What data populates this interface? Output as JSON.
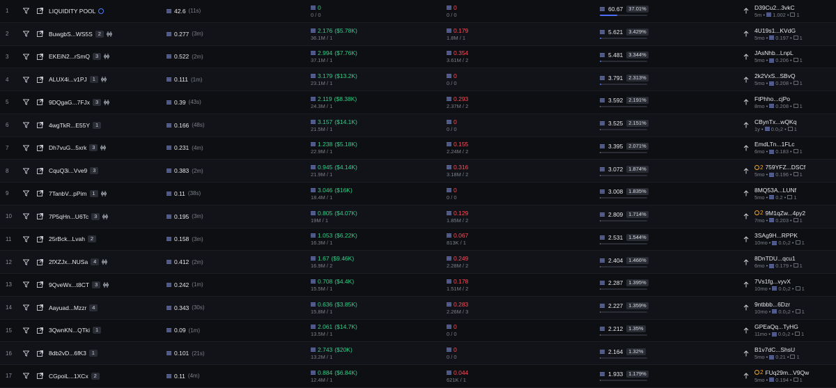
{
  "rows": [
    {
      "idx": "1",
      "name": "LIQUIDITY POOL",
      "count": "",
      "pair": false,
      "info": true,
      "liq": "42.6",
      "age": "(11s)",
      "buy": "0",
      "buy_usd": "",
      "buy_sub": "0 / 0",
      "sell": "0",
      "sell_sub": "0 / 0",
      "vol": "60.67",
      "pct": "37.01%",
      "share": 0.3701,
      "warn": "",
      "addr": "D39Cu2...3vkC",
      "ago": "5m",
      "bal": "1.002",
      "holders": "1"
    },
    {
      "idx": "2",
      "name": "BuwgbS...WS5S",
      "count": "2",
      "pair": true,
      "info": false,
      "liq": "0.277",
      "age": "(3m)",
      "buy": "2.176",
      "buy_usd": "($5.78K)",
      "buy_sub": "36.1M / 1",
      "sell": "0.179",
      "sell_sub": "1.8M / 1",
      "vol": "5.621",
      "pct": "3.429%",
      "share": 0.03429,
      "warn": "",
      "addr": "4U19s1...KVdG",
      "ago": "5mo",
      "bal": "0.197",
      "holders": "1"
    },
    {
      "idx": "3",
      "name": "EKEiN2...rSmQ",
      "count": "3",
      "pair": true,
      "info": false,
      "liq": "0.522",
      "age": "(2m)",
      "buy": "2.994",
      "buy_usd": "($7.76K)",
      "buy_sub": "37.1M / 1",
      "sell": "0.354",
      "sell_sub": "3.61M / 2",
      "vol": "5.481",
      "pct": "3.344%",
      "share": 0.03344,
      "warn": "",
      "addr": "JAsNhb...LnpL",
      "ago": "5mo",
      "bal": "0.206",
      "holders": "1"
    },
    {
      "idx": "4",
      "name": "ALUX4i...v1PJ",
      "count": "1",
      "pair": true,
      "info": false,
      "liq": "0.111",
      "age": "(1m)",
      "buy": "3.179",
      "buy_usd": "($13.2K)",
      "buy_sub": "23.1M / 1",
      "sell": "0",
      "sell_sub": "0 / 0",
      "vol": "3.791",
      "pct": "2.313%",
      "share": 0.02313,
      "warn": "",
      "addr": "2k2VxS...SBvQ",
      "ago": "5mo",
      "bal": "0.208",
      "holders": "1"
    },
    {
      "idx": "5",
      "name": "9DQgaG...7FJx",
      "count": "3",
      "pair": true,
      "info": false,
      "liq": "0.39",
      "age": "(43s)",
      "buy": "2.119",
      "buy_usd": "($8.38K)",
      "buy_sub": "24.3M / 1",
      "sell": "0.293",
      "sell_sub": "2.37M / 2",
      "vol": "3.592",
      "pct": "2.191%",
      "share": 0.02191,
      "warn": "",
      "addr": "FtPhho...cjPo",
      "ago": "8mo",
      "bal": "0.208",
      "holders": "1"
    },
    {
      "idx": "6",
      "name": "4wgTkR...E55Y",
      "count": "1",
      "pair": false,
      "info": false,
      "liq": "0.166",
      "age": "(48s)",
      "buy": "3.157",
      "buy_usd": "($14.1K)",
      "buy_sub": "21.5M / 1",
      "sell": "0",
      "sell_sub": "0 / 0",
      "vol": "3.525",
      "pct": "2.151%",
      "share": 0.02151,
      "warn": "",
      "addr": "CBynTx...wQKq",
      "ago": "1y",
      "bal": "0.0₂2",
      "holders": "1"
    },
    {
      "idx": "7",
      "name": "Dh7vuG...5xrk",
      "count": "3",
      "pair": true,
      "info": false,
      "liq": "0.231",
      "age": "(4m)",
      "buy": "1.238",
      "buy_usd": "($5.18K)",
      "buy_sub": "22.9M / 1",
      "sell": "0.155",
      "sell_sub": "2.24M / 2",
      "vol": "3.395",
      "pct": "2.071%",
      "share": 0.02071,
      "warn": "",
      "addr": "EmdLTn...1FLc",
      "ago": "6mo",
      "bal": "0.183",
      "holders": "1"
    },
    {
      "idx": "8",
      "name": "CquQ3i...Vve9",
      "count": "3",
      "pair": false,
      "info": false,
      "liq": "0.383",
      "age": "(2m)",
      "buy": "0.945",
      "buy_usd": "($4.14K)",
      "buy_sub": "21.9M / 1",
      "sell": "0.316",
      "sell_sub": "3.18M / 2",
      "vol": "3.072",
      "pct": "1.874%",
      "share": 0.01874,
      "warn": "2",
      "addr": "759YFZ...DSCf",
      "ago": "5mo",
      "bal": "0.196",
      "holders": "1"
    },
    {
      "idx": "9",
      "name": "7TanbV...pPim",
      "count": "1",
      "pair": true,
      "info": false,
      "liq": "0.11",
      "age": "(38s)",
      "buy": "3.046",
      "buy_usd": "($16K)",
      "buy_sub": "18.4M / 1",
      "sell": "0",
      "sell_sub": "0 / 0",
      "vol": "3.008",
      "pct": "1.835%",
      "share": 0.01835,
      "warn": "",
      "addr": "8MQ53A...LUNf",
      "ago": "5mo",
      "bal": "0.2",
      "holders": "1"
    },
    {
      "idx": "10",
      "name": "7P5qHn...U6Tc",
      "count": "3",
      "pair": true,
      "info": false,
      "liq": "0.195",
      "age": "(3m)",
      "buy": "0.805",
      "buy_usd": "($4.07K)",
      "buy_sub": "19M / 1",
      "sell": "0.129",
      "sell_sub": "1.85M / 2",
      "vol": "2.809",
      "pct": "1.714%",
      "share": 0.01714,
      "warn": "2",
      "addr": "9M1qZw...4py2",
      "ago": "7mo",
      "bal": "0.203",
      "holders": "1"
    },
    {
      "idx": "11",
      "name": "25rBck...Lvah",
      "count": "2",
      "pair": false,
      "info": false,
      "liq": "0.158",
      "age": "(3m)",
      "buy": "1.053",
      "buy_usd": "($6.22K)",
      "buy_sub": "16.3M / 1",
      "sell": "0.067",
      "sell_sub": "813K / 1",
      "vol": "2.531",
      "pct": "1.544%",
      "share": 0.01544,
      "warn": "",
      "addr": "3SAg9H...RPPK",
      "ago": "10mo",
      "bal": "0.0₂2",
      "holders": "1"
    },
    {
      "idx": "12",
      "name": "2fXZJx...NUSa",
      "count": "4",
      "pair": true,
      "info": false,
      "liq": "0.412",
      "age": "(2m)",
      "buy": "1.67",
      "buy_usd": "($9.46K)",
      "buy_sub": "16.9M / 2",
      "sell": "0.249",
      "sell_sub": "2.28M / 2",
      "vol": "2.404",
      "pct": "1.466%",
      "share": 0.01466,
      "warn": "",
      "addr": "8DnTDU...qcu1",
      "ago": "6mo",
      "bal": "0.179",
      "holders": "1"
    },
    {
      "idx": "13",
      "name": "9QveWx...t8CT",
      "count": "3",
      "pair": true,
      "info": false,
      "liq": "0.242",
      "age": "(1m)",
      "buy": "0.708",
      "buy_usd": "($4.4K)",
      "buy_sub": "15.5M / 1",
      "sell": "0.178",
      "sell_sub": "1.51M / 2",
      "vol": "2.287",
      "pct": "1.395%",
      "share": 0.01395,
      "warn": "",
      "addr": "7Vs1fg...vyvX",
      "ago": "10mo",
      "bal": "0.0₂2",
      "holders": "1"
    },
    {
      "idx": "14",
      "name": "Aayuad...Mzzr",
      "count": "4",
      "pair": false,
      "info": false,
      "liq": "0.343",
      "age": "(30s)",
      "buy": "0.636",
      "buy_usd": "($3.85K)",
      "buy_sub": "15.8M / 1",
      "sell": "0.283",
      "sell_sub": "2.26M / 3",
      "vol": "2.227",
      "pct": "1.359%",
      "share": 0.01359,
      "warn": "",
      "addr": "9ntbbb...6Dzr",
      "ago": "10mo",
      "bal": "0.0₂2",
      "holders": "1"
    },
    {
      "idx": "15",
      "name": "3QwnKN...QTki",
      "count": "1",
      "pair": false,
      "info": false,
      "liq": "0.09",
      "age": "(1m)",
      "buy": "2.061",
      "buy_usd": "($14.7K)",
      "buy_sub": "13.5M / 1",
      "sell": "0",
      "sell_sub": "0 / 0",
      "vol": "2.212",
      "pct": "1.35%",
      "share": 0.0135,
      "warn": "",
      "addr": "GPEaQq...TyHG",
      "ago": "11mo",
      "bal": "0.0₂2",
      "holders": "1"
    },
    {
      "idx": "16",
      "name": "8db2vD...6fK3",
      "count": "1",
      "pair": false,
      "info": false,
      "liq": "0.101",
      "age": "(21s)",
      "buy": "2.743",
      "buy_usd": "($20K)",
      "buy_sub": "13.2M / 1",
      "sell": "0",
      "sell_sub": "0 / 0",
      "vol": "2.164",
      "pct": "1.32%",
      "share": 0.0132,
      "warn": "",
      "addr": "B1v7dC...ShsU",
      "ago": "5mo",
      "bal": "0.21",
      "holders": "1"
    },
    {
      "idx": "17",
      "name": "CGpoiL...1XCx",
      "count": "2",
      "pair": false,
      "info": false,
      "liq": "0.11",
      "age": "(4m)",
      "buy": "0.884",
      "buy_usd": "($6.84K)",
      "buy_sub": "12.4M / 1",
      "sell": "0.044",
      "sell_sub": "621K / 1",
      "vol": "1.933",
      "pct": "1.179%",
      "share": 0.01179,
      "warn": "2",
      "addr": "FUq29m...V9Qw",
      "ago": "5mo",
      "bal": "0.194",
      "holders": "1"
    }
  ],
  "colors": {
    "buy": "#2fd28a",
    "sell": "#ff4d5d",
    "accent": "#4c6fff",
    "warn": "#f5a623"
  },
  "icons": {
    "filter": "filter-icon",
    "external": "external-link-icon",
    "sol": "sol-icon",
    "arrow": "arrow-up-icon",
    "pair": "pair-icon",
    "info": "info-icon",
    "warn": "warning-icon",
    "holders": "holders-icon"
  }
}
